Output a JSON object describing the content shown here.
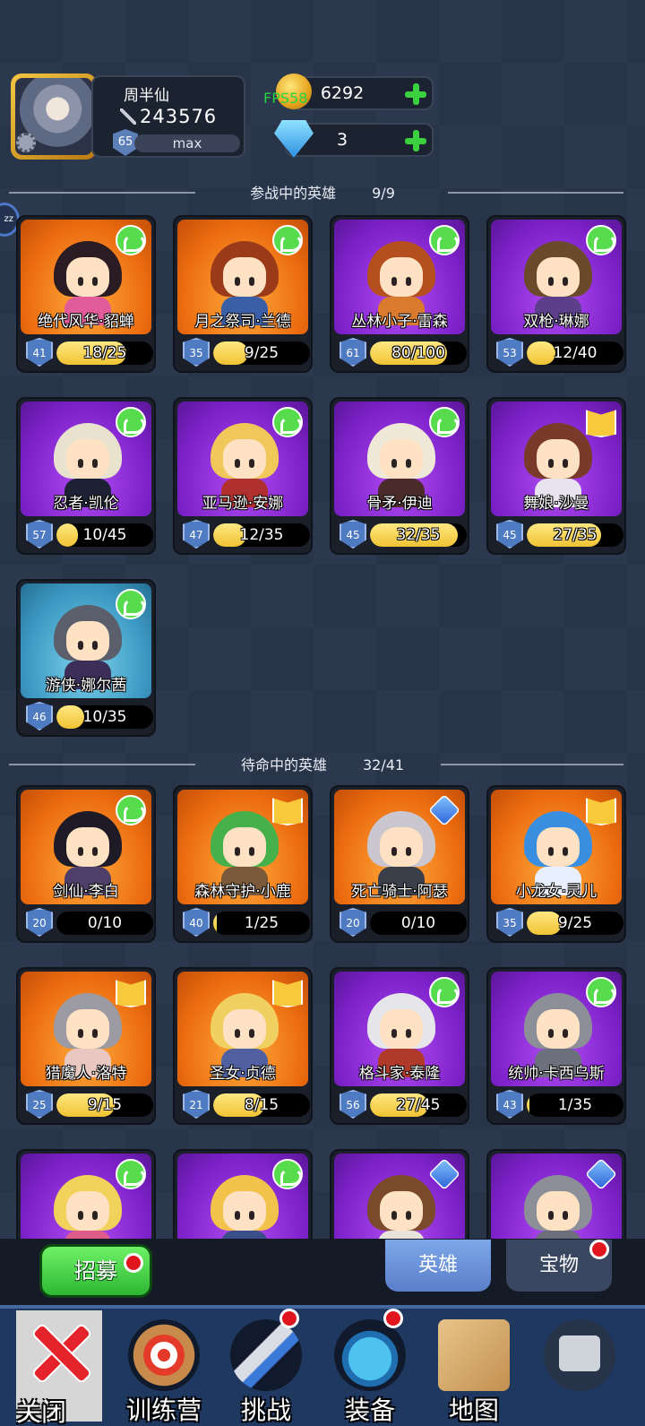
{
  "player": {
    "name": "周半仙",
    "power": "243576",
    "level": "65",
    "max_label": "max"
  },
  "resources": {
    "gold": "6292",
    "gems": "3",
    "fps_label": "FPS58"
  },
  "fighting": {
    "title": "参战中的英雄",
    "count": "9/9"
  },
  "standby": {
    "title": "待命中的英雄",
    "count": "32/41"
  },
  "heroes_fighting": [
    {
      "name": "绝代风华·貂蝉",
      "level": "41",
      "progress": "18/25",
      "ratio": 0.72,
      "rarity": "orange",
      "badge": "wing-icon",
      "hair": "#2a1c22",
      "body": "#e25b9a"
    },
    {
      "name": "月之祭司·兰德",
      "level": "35",
      "progress": "9/25",
      "ratio": 0.36,
      "rarity": "orange",
      "badge": "wing-icon",
      "hair": "#9a3a18",
      "body": "#3a5fa6"
    },
    {
      "name": "丛林小子·雷森",
      "level": "61",
      "progress": "80/100",
      "ratio": 0.8,
      "rarity": "purple",
      "badge": "wing-icon",
      "hair": "#b5501e",
      "body": "#d97a2e"
    },
    {
      "name": "双枪·琳娜",
      "level": "53",
      "progress": "12/40",
      "ratio": 0.3,
      "rarity": "purple",
      "badge": "wing-icon",
      "hair": "#6a4a2a",
      "body": "#5b3f8a"
    },
    {
      "name": "忍者·凯伦",
      "level": "57",
      "progress": "10/45",
      "ratio": 0.22,
      "rarity": "purple",
      "badge": "wing-icon",
      "hair": "#e8e2cf",
      "body": "#1c2233"
    },
    {
      "name": "亚马逊·安娜",
      "level": "47",
      "progress": "12/35",
      "ratio": 0.34,
      "rarity": "purple",
      "badge": "wing-icon",
      "hair": "#f0c85a",
      "body": "#b03030"
    },
    {
      "name": "骨矛·伊迪",
      "level": "45",
      "progress": "32/35",
      "ratio": 0.91,
      "rarity": "purple",
      "badge": "wing-icon",
      "hair": "#efe8d6",
      "body": "#4b2a2a"
    },
    {
      "name": "舞娘·沙曼",
      "level": "45",
      "progress": "27/35",
      "ratio": 0.77,
      "rarity": "purple",
      "badge": "book-icon",
      "hair": "#7a3a2a",
      "body": "#e9e2ef"
    },
    {
      "name": "游侠·娜尔茜",
      "level": "46",
      "progress": "10/35",
      "ratio": 0.29,
      "rarity": "blue",
      "badge": "wing-icon",
      "hair": "#5a5f6b",
      "body": "#3b2f5a"
    }
  ],
  "heroes_standby": [
    {
      "name": "剑仙·李白",
      "level": "20",
      "progress": "0/10",
      "ratio": 0,
      "rarity": "orange",
      "badge": "wing-icon",
      "hair": "#1e1a26",
      "body": "#4d3f6a"
    },
    {
      "name": "森林守护·小鹿",
      "level": "40",
      "progress": "1/25",
      "ratio": 0.04,
      "rarity": "orange",
      "badge": "book-icon",
      "hair": "#46b04a",
      "body": "#7a5a3a"
    },
    {
      "name": "死亡骑士·阿瑟",
      "level": "20",
      "progress": "0/10",
      "ratio": 0,
      "rarity": "orange",
      "badge": "potion-icon",
      "hair": "#c9c6cf",
      "body": "#3b3f4a"
    },
    {
      "name": "小龙女·灵儿",
      "level": "35",
      "progress": "9/25",
      "ratio": 0.36,
      "rarity": "orange",
      "badge": "book-icon",
      "hair": "#3a8ee0",
      "body": "#e8f0ff"
    },
    {
      "name": "猎魔人·洛特",
      "level": "25",
      "progress": "9/15",
      "ratio": 0.6,
      "rarity": "orange",
      "badge": "book-icon",
      "hair": "#9c9aa2",
      "body": "#e8c8c0"
    },
    {
      "name": "圣女·贞德",
      "level": "21",
      "progress": "8/15",
      "ratio": 0.53,
      "rarity": "orange",
      "badge": "book-icon",
      "hair": "#f0d060",
      "body": "#5060a0"
    },
    {
      "name": "格斗家·泰隆",
      "level": "56",
      "progress": "27/45",
      "ratio": 0.6,
      "rarity": "purple",
      "badge": "wing-icon",
      "hair": "#e6e6ea",
      "body": "#b03a2a"
    },
    {
      "name": "统帅·卡西乌斯",
      "level": "43",
      "progress": "1/35",
      "ratio": 0.03,
      "rarity": "purple",
      "badge": "wing-icon",
      "hair": "#8c8f98",
      "body": "#6c707c"
    },
    {
      "name": "",
      "level": "",
      "progress": "",
      "ratio": 0,
      "rarity": "purple",
      "badge": "wing-icon",
      "hair": "#f1d25a",
      "body": "#e05c8a"
    },
    {
      "name": "",
      "level": "",
      "progress": "",
      "ratio": 0,
      "rarity": "purple",
      "badge": "wing-icon",
      "hair": "#f3c24a",
      "body": "#3a4f8a"
    },
    {
      "name": "",
      "level": "",
      "progress": "",
      "ratio": 0,
      "rarity": "purple",
      "badge": "potion-icon",
      "hair": "#7a4a2a",
      "body": "#e8e2da"
    },
    {
      "name": "",
      "level": "",
      "progress": "",
      "ratio": 0,
      "rarity": "purple",
      "badge": "potion-icon",
      "hair": "#8c8f98",
      "body": "#6c707c"
    }
  ],
  "bottom": {
    "recruit": "招募",
    "tab_heroes": "英雄",
    "tab_treasure": "宝物"
  },
  "nav": [
    {
      "label": "关闭",
      "icon": "close-icon"
    },
    {
      "label": "训练营",
      "icon": "target-icon"
    },
    {
      "label": "挑战",
      "icon": "sword-icon"
    },
    {
      "label": "装备",
      "icon": "armor-icon"
    },
    {
      "label": "地图",
      "icon": "map-icon"
    },
    {
      "label": "",
      "icon": "locked-icon"
    }
  ]
}
